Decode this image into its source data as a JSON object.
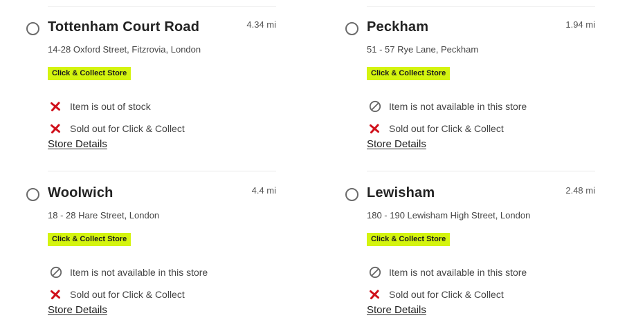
{
  "colors": {
    "badge_background": "#d4f40f",
    "cross_icon": "#d0101b",
    "unavailable_icon": "#666666",
    "divider": "#e8e8e8"
  },
  "stores": [
    {
      "name": "Tottenham Court Road",
      "distance": "4.34 mi",
      "address": "14-28 Oxford Street, Fitzrovia, London",
      "badge": "Click & Collect Store",
      "statuses": [
        {
          "icon": "cross-icon",
          "text": "Item is out of stock"
        },
        {
          "icon": "cross-icon",
          "text": "Sold out for Click & Collect"
        }
      ],
      "details_link": "Store Details"
    },
    {
      "name": "Peckham",
      "distance": "1.94 mi",
      "address": "51 - 57 Rye Lane, Peckham",
      "badge": "Click & Collect Store",
      "statuses": [
        {
          "icon": "unavailable-icon",
          "text": "Item is not available in this store"
        },
        {
          "icon": "cross-icon",
          "text": "Sold out for Click & Collect"
        }
      ],
      "details_link": "Store Details"
    },
    {
      "name": "Woolwich",
      "distance": "4.4 mi",
      "address": "18 - 28 Hare Street, London",
      "badge": "Click & Collect Store",
      "statuses": [
        {
          "icon": "unavailable-icon",
          "text": "Item is not available in this store"
        },
        {
          "icon": "cross-icon",
          "text": "Sold out for Click & Collect"
        }
      ],
      "details_link": "Store Details"
    },
    {
      "name": "Lewisham",
      "distance": "2.48 mi",
      "address": "180 - 190 Lewisham High Street, London",
      "badge": "Click & Collect Store",
      "statuses": [
        {
          "icon": "unavailable-icon",
          "text": "Item is not available in this store"
        },
        {
          "icon": "cross-icon",
          "text": "Sold out for Click & Collect"
        }
      ],
      "details_link": "Store Details"
    }
  ]
}
